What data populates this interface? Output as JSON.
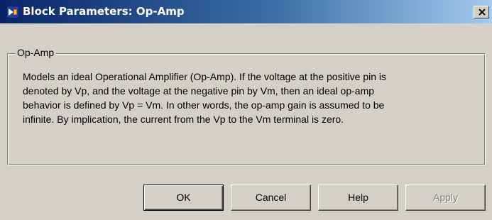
{
  "window": {
    "title": "Block Parameters: Op-Amp",
    "icon": "simulink-block-icon",
    "close_icon": "close-icon"
  },
  "group": {
    "label": "Op-Amp",
    "description_lines": [
      "Models an ideal Operational Amplifier (Op-Amp). If the voltage at the positive pin is",
      "denoted by Vp, and the voltage at the negative pin by Vm, then an ideal op-amp",
      "behavior is defined by Vp = Vm. In other words, the op-amp gain is assumed to be",
      "infinite. By implication, the current from the Vp to the Vm terminal is zero."
    ]
  },
  "buttons": {
    "ok": "OK",
    "cancel": "Cancel",
    "help": "Help",
    "apply": "Apply"
  },
  "colors": {
    "titlebar_start": "#0a246a",
    "titlebar_end": "#a6caf0",
    "face": "#d4d0c8",
    "disabled_text": "#808080"
  }
}
